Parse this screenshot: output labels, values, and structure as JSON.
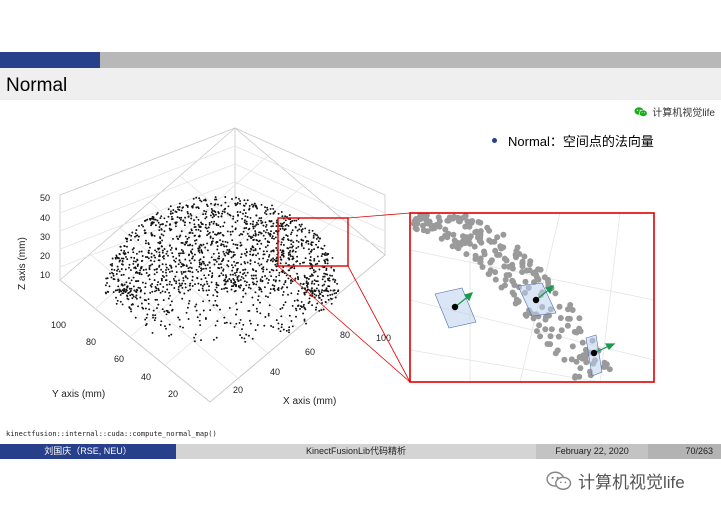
{
  "slide": {
    "title": "Normal",
    "bullet": "Normal：空间点的法向量",
    "code": "kinectfusion::internal::cuda::compute_normal_map()"
  },
  "watermark": {
    "top_text": "计算机视觉life",
    "bottom_text": "计算机视觉life",
    "icon": "wechat-icon"
  },
  "plot": {
    "x_axis_label": "X axis (mm)",
    "y_axis_label": "Y axis (mm)",
    "z_axis_label": "Z axis (mm)",
    "x_ticks": [
      "20",
      "40",
      "60",
      "80",
      "100"
    ],
    "y_ticks": [
      "20",
      "40",
      "60",
      "80",
      "100"
    ],
    "z_ticks": [
      "10",
      "20",
      "30",
      "40",
      "50"
    ]
  },
  "footer": {
    "author": "刘国庆（RSE, NEU）",
    "project": "KinectFusionLib代码精析",
    "date": "February 22, 2020",
    "page": "70/263"
  },
  "colors": {
    "accent_blue": "#283f8c",
    "highlight_red": "#e00000",
    "normal_green": "#1a9a50",
    "point_gray": "#9a9a9a"
  }
}
